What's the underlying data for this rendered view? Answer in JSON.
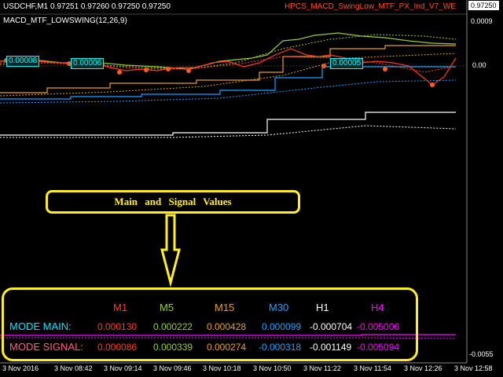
{
  "header": {
    "symbol_ohlc": "USDCHF,M1  0.97251 0.97260 0.97250 0.97250",
    "indicator_label": "MACD_MTF_LOWSWING(12,26,9)",
    "title_right": "HPCS_MACD_SwingLow_MTF_PX_Ind_V7_WE"
  },
  "price_scale": {
    "current_price": "0.97250",
    "top": "0.0009",
    "zero": "0.00",
    "bottom": "-0.0055"
  },
  "value_boxes": [
    "0.00008",
    "0.00006",
    "0.00005"
  ],
  "callout": {
    "text": "Main and Signal Values"
  },
  "table": {
    "timeframes": [
      {
        "label": "M1",
        "color": "#ff3b1f"
      },
      {
        "label": "M5",
        "color": "#9acd32"
      },
      {
        "label": "M15",
        "color": "#e6a020"
      },
      {
        "label": "M30",
        "color": "#1e9fff"
      },
      {
        "label": "H1",
        "color": "#ffffff"
      },
      {
        "label": "H4",
        "color": "#ff00ff"
      }
    ],
    "rows": [
      {
        "label": "MODE MAIN:",
        "color": "#00e5ff",
        "values": [
          "0.000130",
          "0.000222",
          "0.000428",
          "0.000099",
          "-0.000704",
          "-0.005006"
        ]
      },
      {
        "label": "MODE SIGNAL:",
        "color": "#ff5c8a",
        "values": [
          "0.000086",
          "0.000339",
          "0.000274",
          "-0.000318",
          "-0.001149",
          "-0.005094"
        ]
      }
    ]
  },
  "time_axis": [
    "3 Nov 2016",
    "3 Nov 08:42",
    "3 Nov 09:14",
    "3 Nov 09:46",
    "3 Nov 10:18",
    "3 Nov 10:50",
    "3 Nov 11:22",
    "3 Nov 11:54",
    "3 Nov 12:26",
    "3 Nov 12:58"
  ],
  "colors": {
    "background": "#000000",
    "highlight": "#ffee22",
    "zero_line": "#555555"
  }
}
